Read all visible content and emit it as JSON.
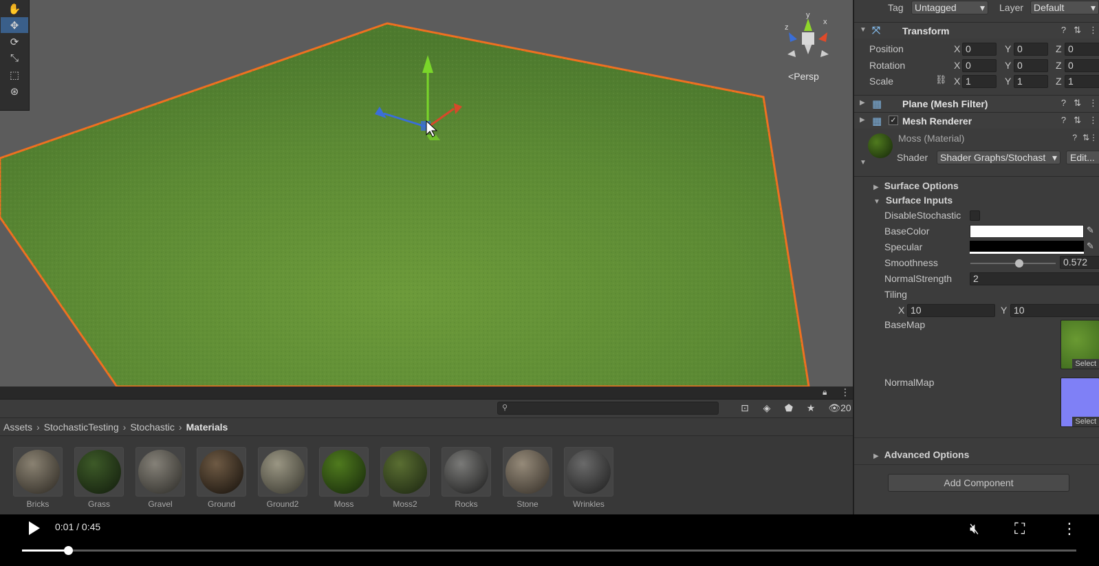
{
  "scene": {
    "camera_mode": "Persp",
    "tools": [
      "hand-tool",
      "move-tool",
      "rotate-tool",
      "scale-tool",
      "rect-tool",
      "transform-tool"
    ],
    "active_tool": "move-tool",
    "gizmo_labels": {
      "y": "y",
      "x": "x",
      "z": "z"
    }
  },
  "project": {
    "hidden_count": "20",
    "breadcrumb": [
      "Assets",
      "StochasticTesting",
      "Stochastic",
      "Materials"
    ],
    "assets": [
      {
        "name": "Bricks",
        "color_a": "#8a8272",
        "color_b": "#2b2721"
      },
      {
        "name": "Grass",
        "color_a": "#3d5a28",
        "color_b": "#111b0c"
      },
      {
        "name": "Gravel",
        "color_a": "#858178",
        "color_b": "#2b2a26"
      },
      {
        "name": "Ground",
        "color_a": "#6e5a44",
        "color_b": "#140f0a"
      },
      {
        "name": "Ground2",
        "color_a": "#9a9683",
        "color_b": "#35342c"
      },
      {
        "name": "Moss",
        "color_a": "#4f7a1e",
        "color_b": "#15260a"
      },
      {
        "name": "Moss2",
        "color_a": "#5a6e32",
        "color_b": "#1a2410"
      },
      {
        "name": "Rocks",
        "color_a": "#7a7a78",
        "color_b": "#1a1a1a"
      },
      {
        "name": "Stone",
        "color_a": "#958a79",
        "color_b": "#332d26"
      },
      {
        "name": "Wrinkles",
        "color_a": "#6a6a6a",
        "color_b": "#1c1c1c"
      }
    ]
  },
  "inspector": {
    "tag_label": "Tag",
    "tag_value": "Untagged",
    "layer_label": "Layer",
    "layer_value": "Default",
    "transform": {
      "title": "Transform",
      "position_label": "Position",
      "rotation_label": "Rotation",
      "scale_label": "Scale",
      "position": {
        "x": "0",
        "y": "0",
        "z": "0"
      },
      "rotation": {
        "x": "0",
        "y": "0",
        "z": "0"
      },
      "scale": {
        "x": "1",
        "y": "1",
        "z": "1"
      }
    },
    "mesh_filter_title": "Plane (Mesh Filter)",
    "mesh_renderer_title": "Mesh Renderer",
    "material": {
      "name": "Moss (Material)",
      "shader_label": "Shader",
      "shader_value": "Shader Graphs/Stochast",
      "edit_label": "Edit..."
    },
    "surface_options": "Surface Options",
    "surface_inputs": "Surface Inputs",
    "props": {
      "disable_stochastic": "DisableStochastic",
      "base_color": "BaseColor",
      "specular": "Specular",
      "smoothness": "Smoothness",
      "smoothness_value": "0.572",
      "smoothness_fraction": 0.572,
      "normal_strength": "NormalStrength",
      "normal_strength_value": "2",
      "tiling": "Tiling",
      "tiling_x": "10",
      "tiling_y": "10",
      "base_map": "BaseMap",
      "normal_map": "NormalMap",
      "select": "Select"
    },
    "advanced_options": "Advanced Options",
    "add_component": "Add Component"
  },
  "video": {
    "time": "0:01 / 0:45",
    "progress": 0.044
  }
}
